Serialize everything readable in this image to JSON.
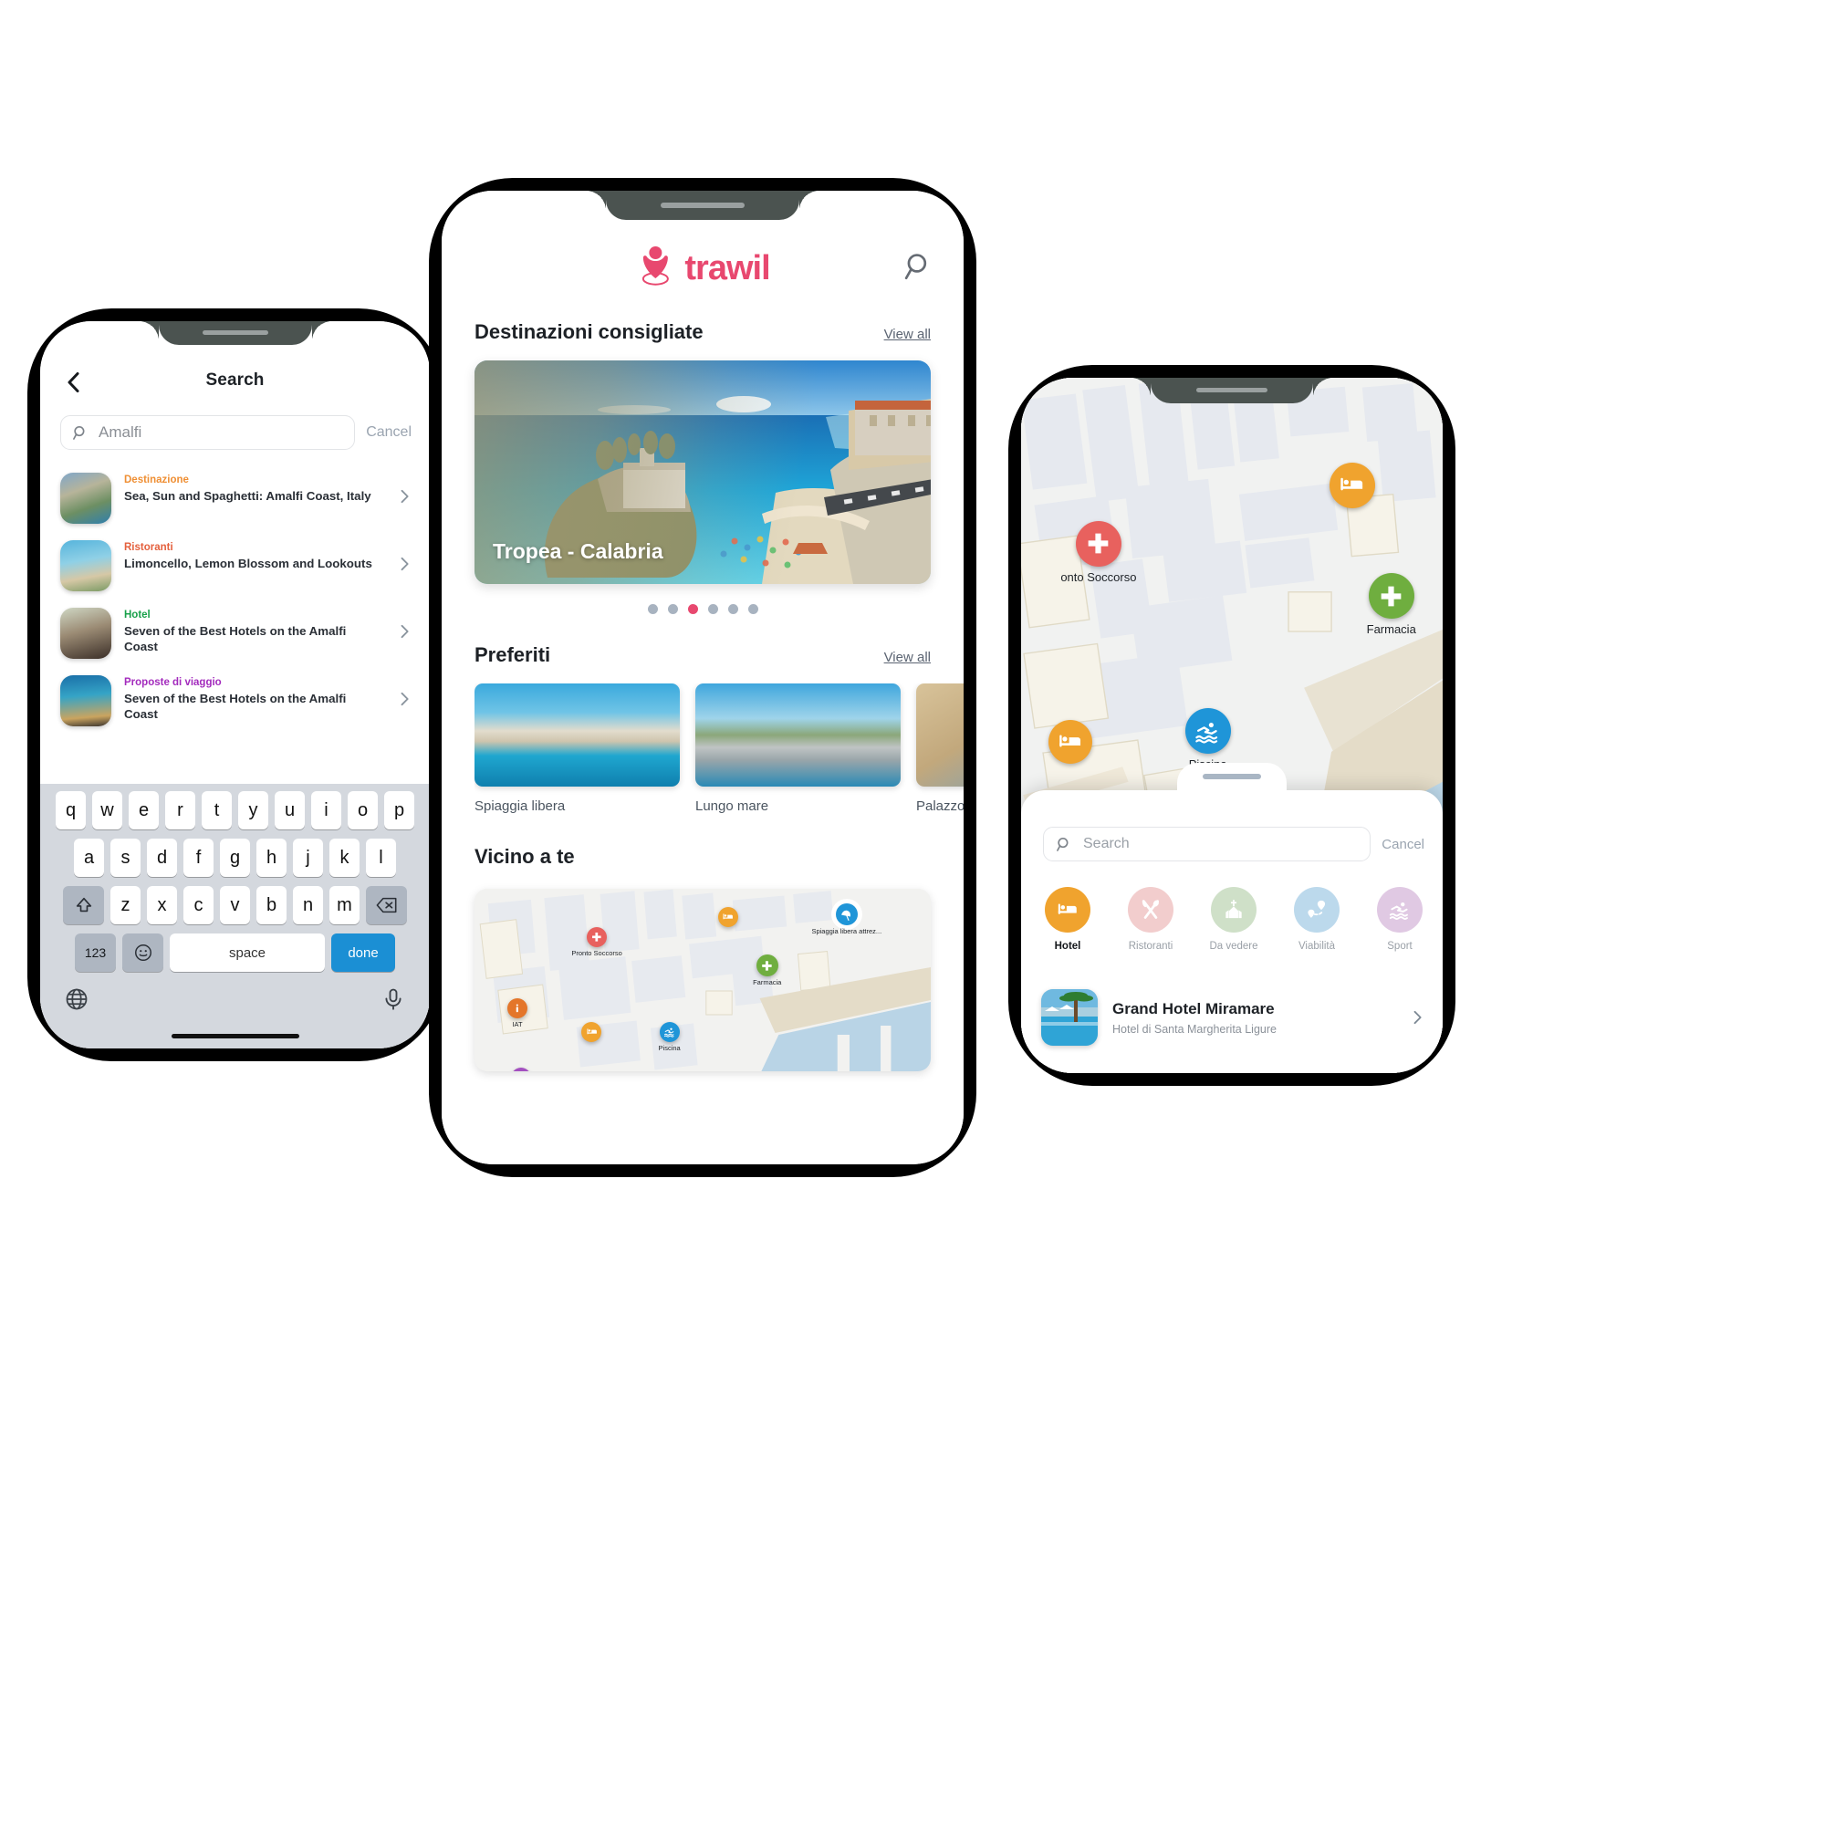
{
  "brand": {
    "name": "trawil",
    "accent": "#e8486f",
    "logo_icon": "person-pin-icon"
  },
  "left_phone": {
    "nav": {
      "back_icon": "chevron-left-icon",
      "title": "Search"
    },
    "search": {
      "icon": "search-icon",
      "value": "Amalfi",
      "placeholder": "Search",
      "cancel_label": "Cancel"
    },
    "results": [
      {
        "category": "Destinazione",
        "category_color": "#ef8f34",
        "title": "Sea, Sun and Spaghetti: Amalfi Coast, Italy",
        "chevron_icon": "chevron-right-icon"
      },
      {
        "category": "Ristoranti",
        "category_color": "#e4603d",
        "title": "Limoncello, Lemon Blossom and Lookouts",
        "chevron_icon": "chevron-right-icon"
      },
      {
        "category": "Hotel",
        "category_color": "#18a04a",
        "title": "Seven of the Best Hotels on the Amalfi Coast",
        "chevron_icon": "chevron-right-icon"
      },
      {
        "category": "Proposte di viaggio",
        "category_color": "#a32bbd",
        "title": "Seven of the Best Hotels on the Amalfi Coast",
        "chevron_icon": "chevron-right-icon"
      }
    ],
    "keyboard": {
      "row1": [
        "q",
        "w",
        "e",
        "r",
        "t",
        "y",
        "u",
        "i",
        "o",
        "p"
      ],
      "row2": [
        "a",
        "s",
        "d",
        "f",
        "g",
        "h",
        "j",
        "k",
        "l"
      ],
      "row3": [
        "z",
        "x",
        "c",
        "v",
        "b",
        "n",
        "m"
      ],
      "shift_icon": "shift-arrow-icon",
      "backspace_icon": "backspace-icon",
      "numbers_label": "123",
      "emoji_icon": "smiley-icon",
      "space_label": "space",
      "done_label": "done",
      "globe_icon": "globe-icon",
      "mic_icon": "microphone-icon"
    }
  },
  "center_phone": {
    "header": {
      "logo_text": "trawil",
      "search_icon": "search-icon"
    },
    "section_destinations": {
      "title": "Destinazioni consigliate",
      "view_all": "View all"
    },
    "hero": {
      "caption": "Tropea - Calabria"
    },
    "carousel": {
      "count": 6,
      "active_index": 2,
      "active_color": "#e8486f",
      "inactive_color": "#a8b3c0"
    },
    "section_favourites": {
      "title": "Preferiti",
      "view_all": "View all"
    },
    "favourites": [
      {
        "label": "Spiaggia libera"
      },
      {
        "label": "Lungo mare"
      },
      {
        "label": "Palazzo D..."
      }
    ],
    "section_nearby": {
      "title": "Vicino a te"
    },
    "mini_map_pins": [
      {
        "label": "Pronto Soccorso",
        "icon": "cross-icon",
        "color": "#e8615e"
      },
      {
        "label": "",
        "icon": "bed-icon",
        "color": "#f0a32e"
      },
      {
        "label": "Spiaggia libera attrez...",
        "icon": "beach-umbrella-icon",
        "color": "#1f95d8"
      },
      {
        "label": "Farmacia",
        "icon": "plus-cross-icon",
        "color": "#6fae3f"
      },
      {
        "label": "IAT",
        "icon": "info-icon",
        "color": "#e4762a"
      },
      {
        "label": "",
        "icon": "bed-icon",
        "color": "#f0a32e"
      },
      {
        "label": "Piscina",
        "icon": "swimmer-icon",
        "color": "#1f95d8"
      },
      {
        "label": "",
        "icon": "plus-cross-icon",
        "color": "#a34fc0"
      }
    ]
  },
  "right_phone": {
    "map_pins": [
      {
        "label": "onto Soccorso",
        "icon": "cross-icon",
        "color": "#e8615e"
      },
      {
        "label": "",
        "icon": "bed-icon",
        "color": "#f0a32e"
      },
      {
        "label": "Farmacia",
        "icon": "plus-cross-icon",
        "color": "#6fae3f"
      },
      {
        "label": "",
        "icon": "bed-icon",
        "color": "#f0a32e"
      },
      {
        "label": "Piscina",
        "icon": "swimmer-icon",
        "color": "#1f95d8"
      },
      {
        "label": "",
        "icon": "bed-icon",
        "color": "#f0a32e"
      }
    ],
    "sheet": {
      "search": {
        "icon": "search-icon",
        "placeholder": "Search",
        "value": "",
        "cancel_label": "Cancel"
      },
      "categories": [
        {
          "label": "Hotel",
          "icon": "bed-icon",
          "color": "#f0a32e",
          "active": true
        },
        {
          "label": "Ristoranti",
          "icon": "cutlery-icon",
          "color": "#f2cdcd",
          "active": false
        },
        {
          "label": "Da vedere",
          "icon": "church-icon",
          "color": "#cfe0c8",
          "active": false
        },
        {
          "label": "Viabilità",
          "icon": "route-icon",
          "color": "#bcd9ec",
          "active": false
        },
        {
          "label": "Sport",
          "icon": "swimmer-icon",
          "color": "#e0c9e3",
          "active": false
        }
      ],
      "result": {
        "name": "Grand Hotel Miramare",
        "subtitle": "Hotel di Santa Margherita Ligure",
        "chevron_icon": "chevron-right-icon"
      }
    }
  }
}
